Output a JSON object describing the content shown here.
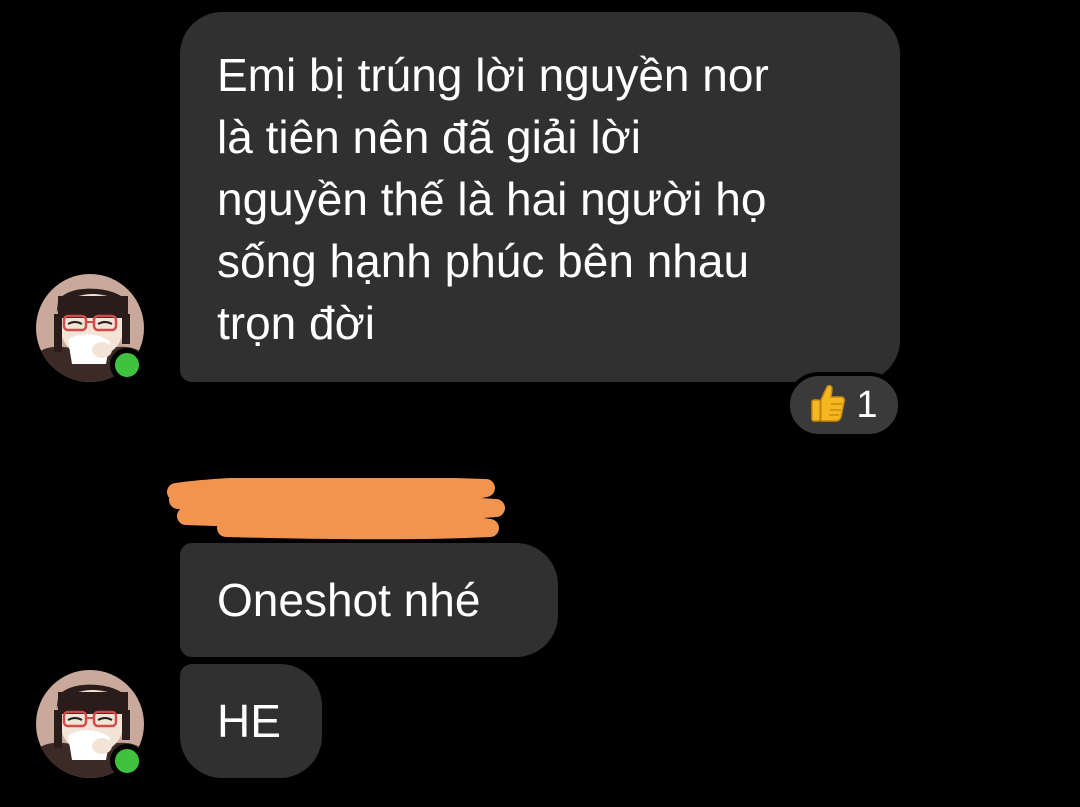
{
  "messages": [
    {
      "lines": [
        "Emi bị trúng lời nguyền nor",
        "là tiên nên đã giải lời",
        "nguyền thế là hai người họ",
        "sống hạnh phúc bên nhau",
        "trọn đời"
      ],
      "reaction": {
        "icon": "thumbs-up-icon",
        "count": "1"
      }
    },
    {
      "text": "Oneshot nhé"
    },
    {
      "text": "HE"
    }
  ],
  "colors": {
    "background": "#000000",
    "bubble": "#303030",
    "reaction_pill": "#3a3a3a",
    "online_indicator": "#3fc33f",
    "redaction_scribble": "#f0944f",
    "thumbs_up": "#f5b820"
  },
  "sender": {
    "avatar_icon": "avatar-icon",
    "online_indicator": "online-dot"
  }
}
